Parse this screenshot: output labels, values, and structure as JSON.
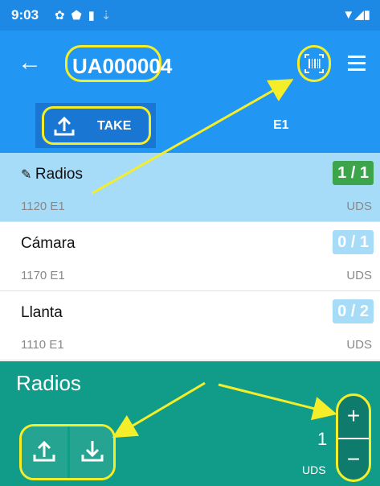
{
  "status_bar": {
    "time": "9:03",
    "icons": [
      "settings-icon",
      "shield-icon",
      "sd-card-icon",
      "download-icon"
    ],
    "right_icons": [
      "wifi-icon",
      "signal-icon",
      "battery-icon"
    ]
  },
  "app_bar": {
    "title": "UA000004",
    "back_icon": "back-arrow-icon",
    "scan_icon": "barcode-scan-icon",
    "menu_icon": "hamburger-menu-icon"
  },
  "tabs": [
    {
      "label": "TAKE",
      "icon": "upload-icon",
      "selected": true
    },
    {
      "label": "E1",
      "selected": false
    }
  ],
  "items": [
    {
      "name": "Radios",
      "code": "1120 E1",
      "unit": "UDS",
      "count": "1 / 1",
      "selected": true,
      "status_color": "#3ca54b"
    },
    {
      "name": "Cámara",
      "code": "1170 E1",
      "unit": "UDS",
      "count": "0 / 1",
      "selected": false,
      "status_color": "#a7dcf9"
    },
    {
      "name": "Llanta",
      "code": "1110 E1",
      "unit": "UDS",
      "count": "0 / 2",
      "selected": false,
      "status_color": "#a7dcf9"
    }
  ],
  "bottom_panel": {
    "title": "Radios",
    "quantity": "1",
    "unit": "UDS",
    "buttons": [
      "upload-icon",
      "download-icon"
    ],
    "plus": "+",
    "minus": "−"
  },
  "colors": {
    "primary": "#2196f3",
    "panel": "#119c8a",
    "highlight": "#f4ee2a",
    "selected_row": "#a7dcf9"
  }
}
